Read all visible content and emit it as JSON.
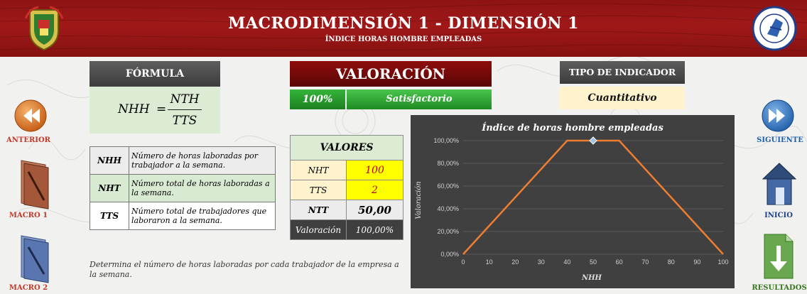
{
  "header": {
    "title": "MACRODIMENSIÓN 1 - DIMENSIÓN 1",
    "subtitle": "ÍNDICE HORAS HOMBRE EMPLEADAS"
  },
  "formula": {
    "heading": "FÓRMULA",
    "lhs": "NHH",
    "equals": "=",
    "numerator": "NTH",
    "denominator": "TTS"
  },
  "valoracion": {
    "heading": "VALORACIÓN",
    "percent": "100%",
    "status": "Satisfactorio",
    "status_color": "#2e9e33"
  },
  "tipo": {
    "heading": "TIPO DE INDICADOR",
    "value": "Cuantitativo"
  },
  "nav": {
    "anterior": "ANTERIOR",
    "siguiente": "SIGUIENTE",
    "macro1": "MACRO 1",
    "macro2": "MACRO 2",
    "inicio": "INICIO",
    "resultados": "RESULTADOS"
  },
  "definitions": [
    {
      "key": "NHH",
      "desc": "Número de horas laboradas por trabajador a la semana."
    },
    {
      "key": "NHT",
      "desc": "Número total de horas laboradas a la semana."
    },
    {
      "key": "TTS",
      "desc": "Número total de trabajadores que laboraron a la semana."
    }
  ],
  "definitions_note": "Determina el número de horas laboradas por cada trabajador de la empresa a la semana.",
  "valores": {
    "heading": "VALORES",
    "rows": [
      {
        "label": "NHT",
        "value": "100"
      },
      {
        "label": "TTS",
        "value": "2"
      }
    ],
    "ntt_label": "NTT",
    "ntt_value": "50,00",
    "val_label": "Valoración",
    "val_value": "100,00%"
  },
  "chart_data": {
    "type": "line",
    "title": "Índice de horas hombre empleadas",
    "xlabel": "NHH",
    "ylabel": "Valoración",
    "x_ticks": [
      "0",
      "10",
      "20",
      "30",
      "40",
      "50",
      "60",
      "70",
      "80",
      "90",
      "100"
    ],
    "y_ticks": [
      "0,00%",
      "20,00%",
      "40,00%",
      "60,00%",
      "80,00%",
      "100,00%"
    ],
    "xlim": [
      0,
      100
    ],
    "ylim": [
      0,
      100
    ],
    "series": [
      {
        "x": [
          0,
          40,
          60,
          100
        ],
        "y": [
          0,
          100,
          100,
          0
        ],
        "color": "#ed7d31"
      }
    ],
    "marker": {
      "x": 50,
      "y": 100,
      "color": "#9dc3e6"
    },
    "background": "#404040",
    "grid": true
  }
}
